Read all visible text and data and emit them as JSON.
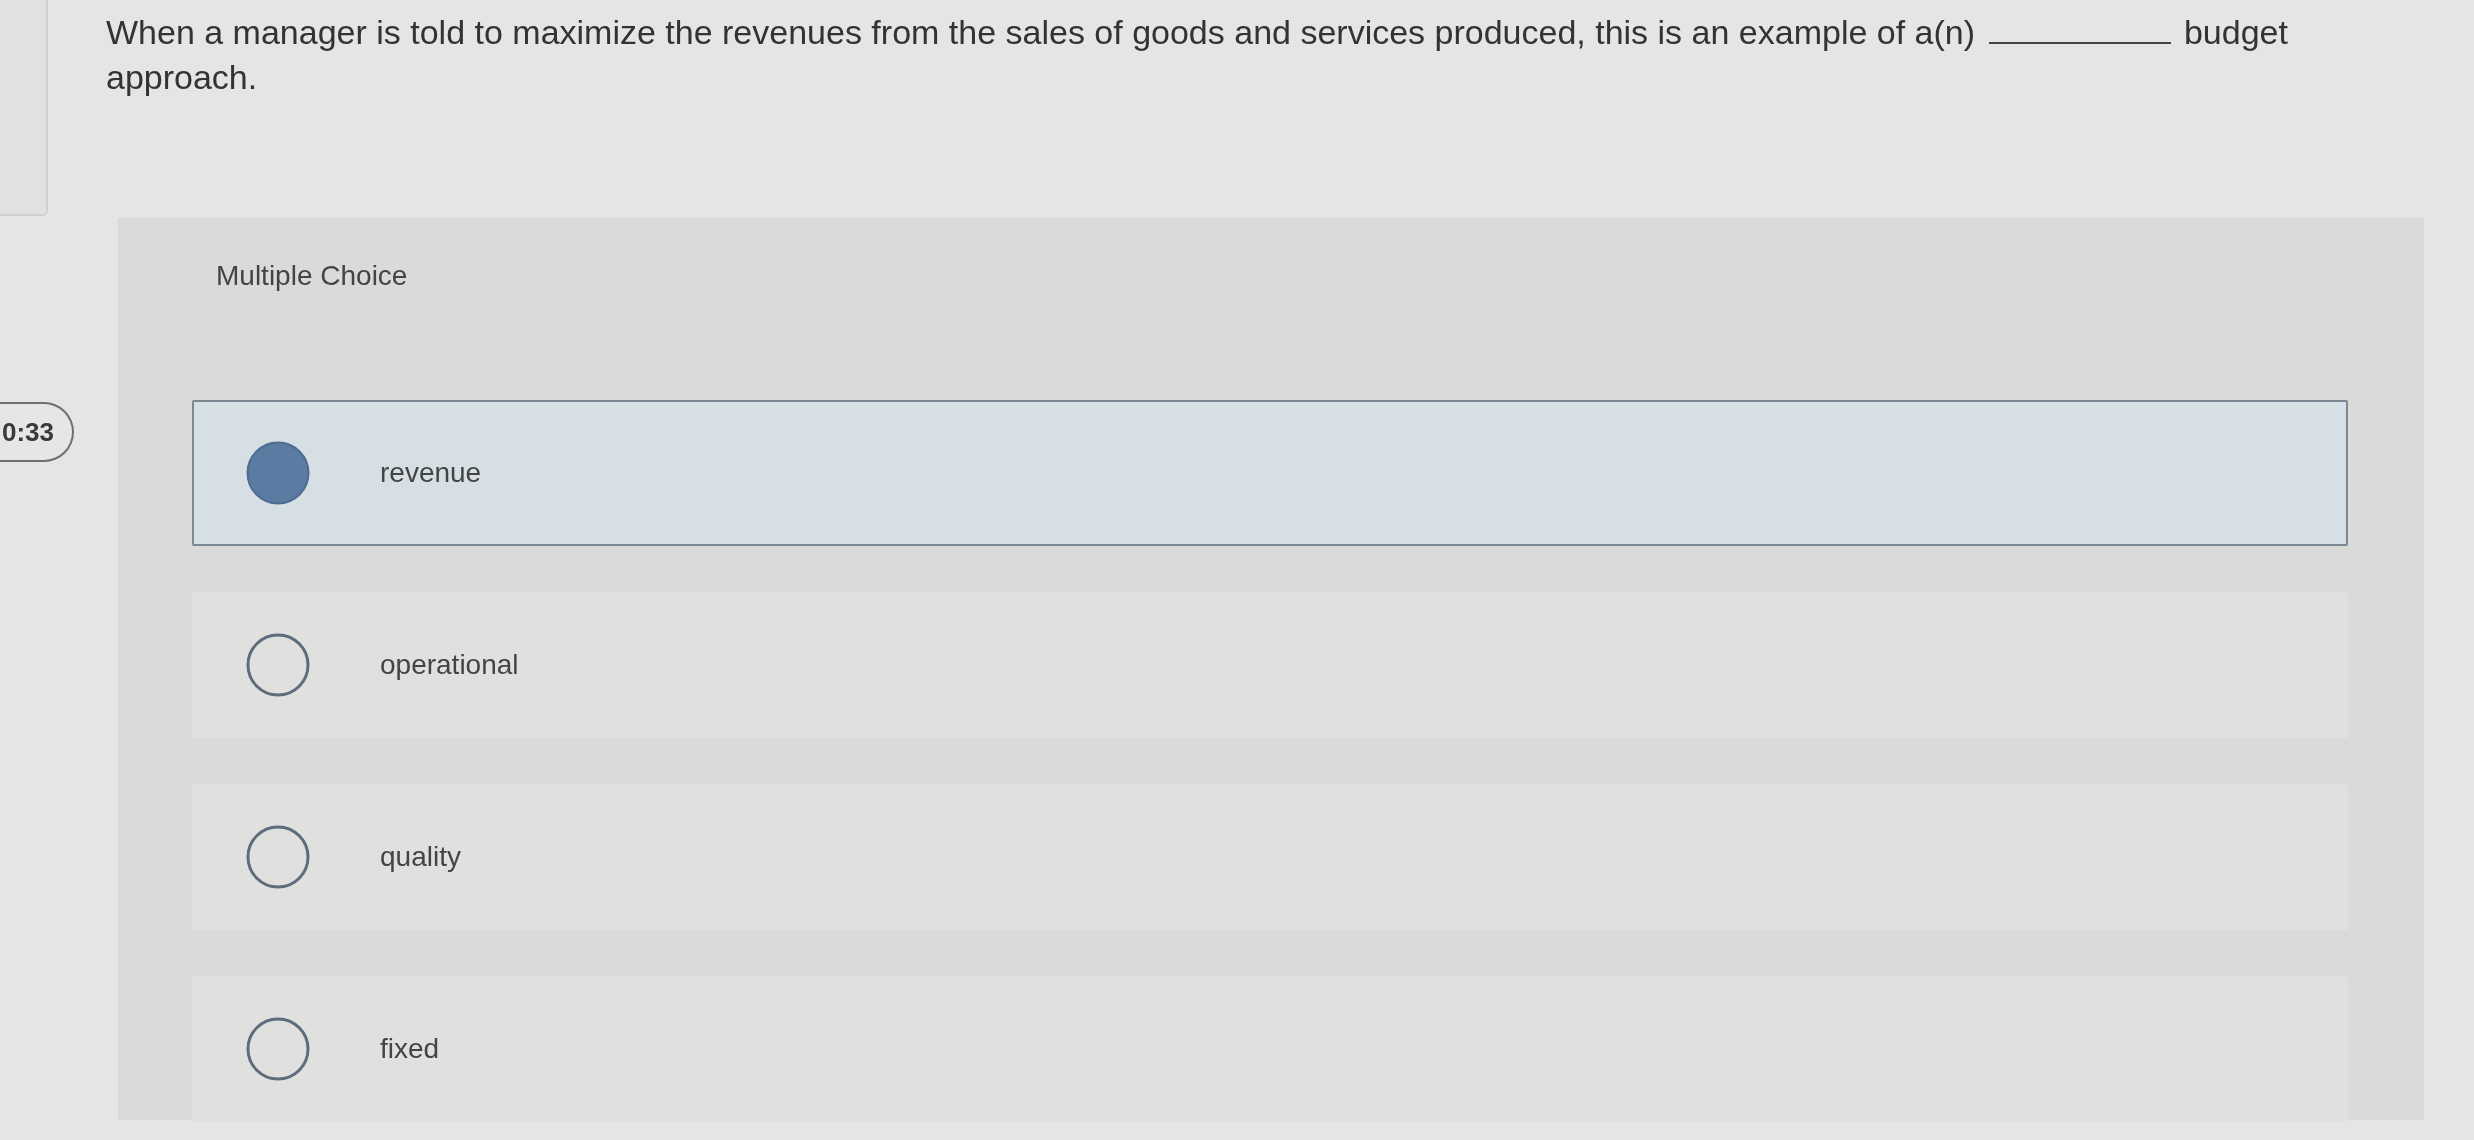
{
  "question": {
    "text_before": "When a manager is told to maximize the revenues from the sales of goods and services produced, this is an example of a(n)",
    "text_after": "budget approach."
  },
  "timer": {
    "text": "0:33"
  },
  "choices": {
    "heading": "Multiple Choice",
    "options": [
      {
        "label": "revenue",
        "selected": true
      },
      {
        "label": "operational",
        "selected": false
      },
      {
        "label": "quality",
        "selected": false
      },
      {
        "label": "fixed",
        "selected": false
      }
    ]
  }
}
